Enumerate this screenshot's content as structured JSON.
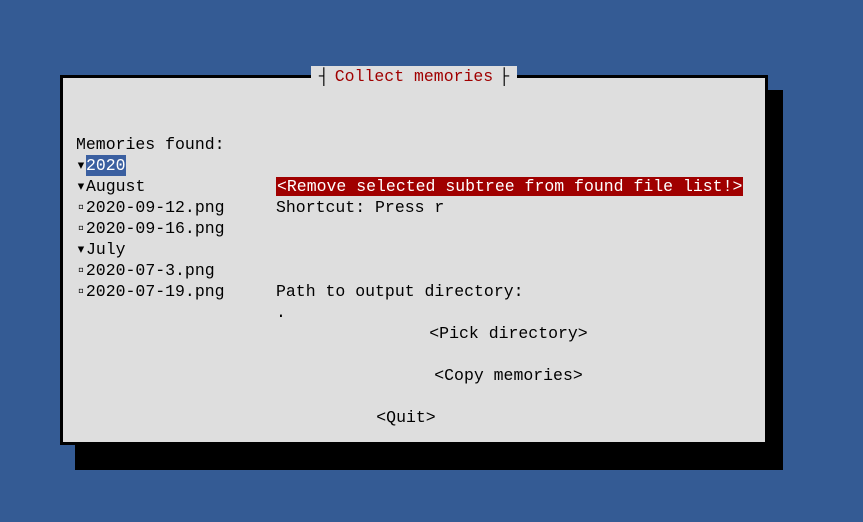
{
  "title": "Collect memories",
  "memories_label": "Memories found:",
  "tree": {
    "root_label": "2020",
    "months": [
      {
        "name": "August",
        "files": [
          "2020-09-12.png",
          "2020-09-16.png"
        ]
      },
      {
        "name": "July",
        "files": [
          "2020-07-3.png",
          "2020-07-19.png"
        ]
      }
    ]
  },
  "buttons": {
    "remove": "<Remove selected subtree from found file list!>",
    "shortcut": "Shortcut: Press r",
    "output_label": "Path to output directory:",
    "input_value": ".",
    "pick": "<Pick directory>",
    "copy": "<Copy memories>",
    "quit": "<Quit>"
  },
  "glyphs": {
    "arrow": "▾",
    "bullet": "▫"
  }
}
